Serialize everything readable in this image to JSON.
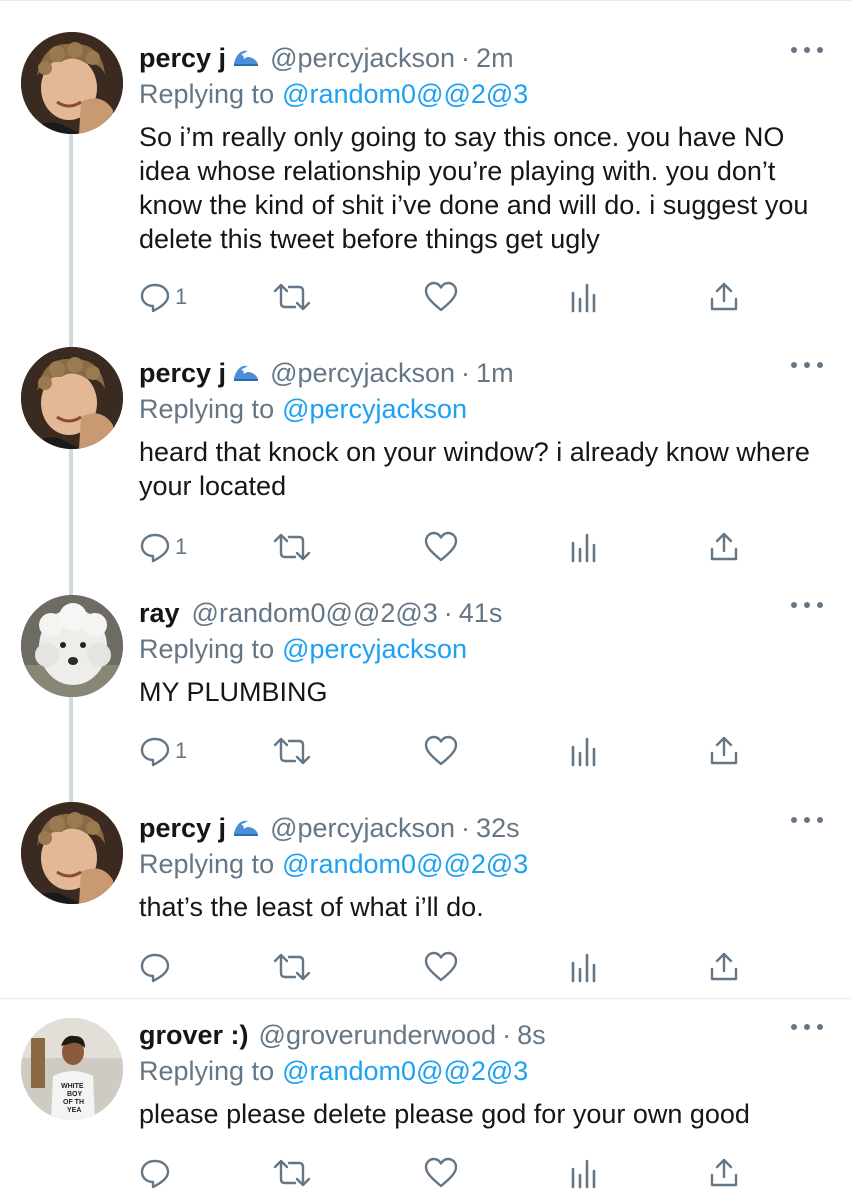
{
  "tweets": [
    {
      "name": "percy j",
      "handle": "@percyjackson",
      "time": "2m",
      "reply_prefix": "Replying to",
      "reply_to": "@random0@@2@3",
      "text": "So i’m really only going to say this once. you have NO idea whose relationship you’re playing with. you don’t know the kind of shit i’ve done and will do. i suggest you delete this tweet before things get ugly",
      "reply_count": "1",
      "avatar": "curly-haired-guy"
    },
    {
      "name": "percy j",
      "handle": "@percyjackson",
      "time": "1m",
      "reply_prefix": "Replying to",
      "reply_to": "@percyjackson",
      "text": "heard that knock on your window? i already know where your located",
      "reply_count": "1",
      "avatar": "curly-haired-guy"
    },
    {
      "name": "ray",
      "handle": "@random0@@2@3",
      "time": "41s",
      "reply_prefix": "Replying to",
      "reply_to": "@percyjackson",
      "text": "MY PLUMBING",
      "reply_count": "1",
      "avatar": "white-dog"
    },
    {
      "name": "percy j",
      "handle": "@percyjackson",
      "time": "32s",
      "reply_prefix": "Replying to",
      "reply_to": "@random0@@2@3",
      "text": "that’s the least of what i’ll do.",
      "reply_count": "",
      "avatar": "curly-haired-guy"
    },
    {
      "name": "grover :)",
      "handle": "@groverunderwood",
      "time": "8s",
      "reply_prefix": "Replying to",
      "reply_to": "@random0@@2@3",
      "text": "please please delete please god for your own good",
      "reply_count": "",
      "avatar": "guy-in-white-tshirt"
    }
  ],
  "icons": {
    "reply": "reply-icon",
    "retweet": "retweet-icon",
    "like": "heart-icon",
    "analytics": "analytics-icon",
    "share": "share-icon",
    "more": "more-icon",
    "emoji": "wave-emoji"
  },
  "colors": {
    "link": "#1da1f2",
    "secondary_text": "#657786",
    "primary_text": "#14171a",
    "thread_line": "#cfd9de"
  }
}
